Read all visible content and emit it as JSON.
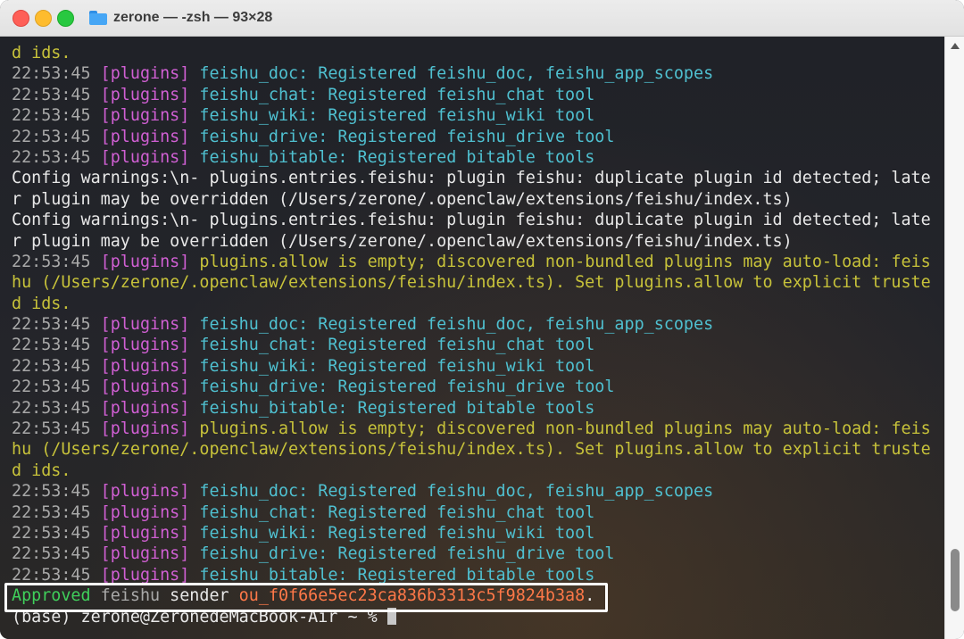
{
  "window": {
    "title": "zerone — -zsh — 93×28",
    "icons": {
      "folder": "folder-icon"
    }
  },
  "terminal": {
    "lines": [
      [
        {
          "t": "d ids.",
          "c": "yl"
        }
      ],
      [
        {
          "t": "22:53:45 ",
          "c": "ts"
        },
        {
          "t": "[plugins] ",
          "c": "tag"
        },
        {
          "t": "feishu_doc: Registered feishu_doc, feishu_app_scopes",
          "c": "cy"
        }
      ],
      [
        {
          "t": "22:53:45 ",
          "c": "ts"
        },
        {
          "t": "[plugins] ",
          "c": "tag"
        },
        {
          "t": "feishu_chat: Registered feishu_chat tool",
          "c": "cy"
        }
      ],
      [
        {
          "t": "22:53:45 ",
          "c": "ts"
        },
        {
          "t": "[plugins] ",
          "c": "tag"
        },
        {
          "t": "feishu_wiki: Registered feishu_wiki tool",
          "c": "cy"
        }
      ],
      [
        {
          "t": "22:53:45 ",
          "c": "ts"
        },
        {
          "t": "[plugins] ",
          "c": "tag"
        },
        {
          "t": "feishu_drive: Registered feishu_drive tool",
          "c": "cy"
        }
      ],
      [
        {
          "t": "22:53:45 ",
          "c": "ts"
        },
        {
          "t": "[plugins] ",
          "c": "tag"
        },
        {
          "t": "feishu_bitable: Registered bitable tools",
          "c": "cy"
        }
      ],
      [
        {
          "t": "Config warnings:\\n- plugins.entries.feishu: plugin feishu: duplicate plugin id detected; late",
          "c": "wh"
        }
      ],
      [
        {
          "t": "r plugin may be overridden (/Users/zerone/.openclaw/extensions/feishu/index.ts)",
          "c": "wh"
        }
      ],
      [
        {
          "t": "Config warnings:\\n- plugins.entries.feishu: plugin feishu: duplicate plugin id detected; late",
          "c": "wh"
        }
      ],
      [
        {
          "t": "r plugin may be overridden (/Users/zerone/.openclaw/extensions/feishu/index.ts)",
          "c": "wh"
        }
      ],
      [
        {
          "t": "22:53:45 ",
          "c": "ts"
        },
        {
          "t": "[plugins] ",
          "c": "tag"
        },
        {
          "t": "plugins.allow is empty; discovered non-bundled plugins may auto-load: feis",
          "c": "yl"
        }
      ],
      [
        {
          "t": "hu (/Users/zerone/.openclaw/extensions/feishu/index.ts). Set plugins.allow to explicit truste",
          "c": "yl"
        }
      ],
      [
        {
          "t": "d ids.",
          "c": "yl"
        }
      ],
      [
        {
          "t": "22:53:45 ",
          "c": "ts"
        },
        {
          "t": "[plugins] ",
          "c": "tag"
        },
        {
          "t": "feishu_doc: Registered feishu_doc, feishu_app_scopes",
          "c": "cy"
        }
      ],
      [
        {
          "t": "22:53:45 ",
          "c": "ts"
        },
        {
          "t": "[plugins] ",
          "c": "tag"
        },
        {
          "t": "feishu_chat: Registered feishu_chat tool",
          "c": "cy"
        }
      ],
      [
        {
          "t": "22:53:45 ",
          "c": "ts"
        },
        {
          "t": "[plugins] ",
          "c": "tag"
        },
        {
          "t": "feishu_wiki: Registered feishu_wiki tool",
          "c": "cy"
        }
      ],
      [
        {
          "t": "22:53:45 ",
          "c": "ts"
        },
        {
          "t": "[plugins] ",
          "c": "tag"
        },
        {
          "t": "feishu_drive: Registered feishu_drive tool",
          "c": "cy"
        }
      ],
      [
        {
          "t": "22:53:45 ",
          "c": "ts"
        },
        {
          "t": "[plugins] ",
          "c": "tag"
        },
        {
          "t": "feishu_bitable: Registered bitable tools",
          "c": "cy"
        }
      ],
      [
        {
          "t": "22:53:45 ",
          "c": "ts"
        },
        {
          "t": "[plugins] ",
          "c": "tag"
        },
        {
          "t": "plugins.allow is empty; discovered non-bundled plugins may auto-load: feis",
          "c": "yl"
        }
      ],
      [
        {
          "t": "hu (/Users/zerone/.openclaw/extensions/feishu/index.ts). Set plugins.allow to explicit truste",
          "c": "yl"
        }
      ],
      [
        {
          "t": "d ids.",
          "c": "yl"
        }
      ],
      [
        {
          "t": "22:53:45 ",
          "c": "ts"
        },
        {
          "t": "[plugins] ",
          "c": "tag"
        },
        {
          "t": "feishu_doc: Registered feishu_doc, feishu_app_scopes",
          "c": "cy"
        }
      ],
      [
        {
          "t": "22:53:45 ",
          "c": "ts"
        },
        {
          "t": "[plugins] ",
          "c": "tag"
        },
        {
          "t": "feishu_chat: Registered feishu_chat tool",
          "c": "cy"
        }
      ],
      [
        {
          "t": "22:53:45 ",
          "c": "ts"
        },
        {
          "t": "[plugins] ",
          "c": "tag"
        },
        {
          "t": "feishu_wiki: Registered feishu_wiki tool",
          "c": "cy"
        }
      ],
      [
        {
          "t": "22:53:45 ",
          "c": "ts"
        },
        {
          "t": "[plugins] ",
          "c": "tag"
        },
        {
          "t": "feishu_drive: Registered feishu_drive tool",
          "c": "cy"
        }
      ],
      [
        {
          "t": "22:53:45 ",
          "c": "ts"
        },
        {
          "t": "[plugins] ",
          "c": "tag"
        },
        {
          "t": "feishu_bitable: Registered bitable tools",
          "c": "cy"
        }
      ]
    ],
    "approved_line": {
      "word": "Approved",
      "channel": " feishu",
      "text": " sender ",
      "sender_id": "ou_f0f66e5ec23ca836b3313c5f9824b3a8",
      "period": "."
    },
    "prompt": "(base) zerone@ZeronedeMacBook-Air ~ % "
  },
  "colors": {
    "timestamp": "#a9a9a9",
    "tag": "#d05fd3",
    "info": "#4fc0d0",
    "warning": "#c7c23a",
    "approved": "#3fcf5a",
    "sender_id": "#ff7848"
  }
}
